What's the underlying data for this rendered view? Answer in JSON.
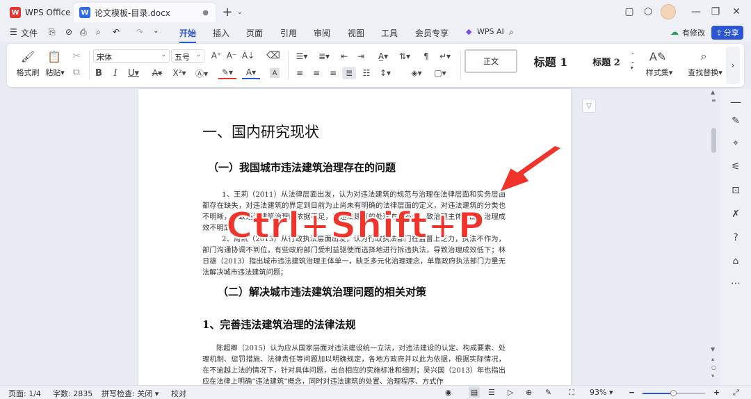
{
  "titlebar": {
    "app_tab": "WPS Office",
    "doc_tab": "论文模板-目录.docx",
    "new_tab": "+",
    "app_logo": "W",
    "doc_logo": "W"
  },
  "menubar": {
    "file": "文件",
    "tabs": [
      "开始",
      "插入",
      "页面",
      "引用",
      "审阅",
      "视图",
      "工具",
      "会员专享"
    ],
    "wps_ai": "WPS AI",
    "edit_mode": "有修改",
    "share": "分享"
  },
  "ribbon": {
    "format_painter": "格式刷",
    "paste": "粘贴",
    "font_name": "宋体",
    "font_size": "五号",
    "style_normal": "正文",
    "style_h1": "标题 1",
    "style_h2": "标题 2",
    "styles": "样式集",
    "find_replace": "查找替换"
  },
  "document": {
    "h1": "一、国内研究现状",
    "h2a": "（一）我国城市违法建筑治理存在的问题",
    "p1": "1、王莉（2011）从法律层面出发，认为对违法建筑的规范与治理在法律层面和实务层面都存在缺失，对违法建筑的界定到目前为止尚未有明确的法律层面的定义，对违法建筑的分类也不明晰，导致违法建筑治理的依据不足，对违法建筑的处理方式不一，致治理主体混乱，治理成效不明显；",
    "p2": "2、周凯（2013）从行政执法层面出发，认为行政执法部门在监督上乏力，执法不作为，部门沟通协调不到位，有些政府部门受利益驱使而选择地进行拆违执法，导致治理成效低下；林日雄（2013）指出城市违法建筑治理主体单一，缺乏多元化治理理念，单靠政府执法部门力量无法解决城市违法建筑问题；",
    "h2b": "（二）解决城市违法建筑治理问题的相关对策",
    "h3": "1、完善违法建筑治理的法律法规",
    "p3": "陈超卿（2015）认为应从国家层面对违法建设统一立法，对违法建设的认定、构成要素、处理机制、惩罚措施、法律责任等问题加以明确规定，各地方政府并以此为依据，根据实际情况，在不逾越上法的情况下，针对具体问题，出台相应的实施标准和细则；吴兴国（2013）年也指出应在法律上明确“违法建筑”概念，同时对违法建筑的处置、治理程序、方式作"
  },
  "overlay": {
    "shortcut": "Ctrl+Shift+P"
  },
  "statusbar": {
    "page": "页面: 1/4",
    "words": "字数: 2835",
    "spell": "拼写检查: 关闭",
    "proof": "校对",
    "zoom": "93%"
  },
  "colors": {
    "accent": "#2a56d6",
    "arrow": "#f0342b"
  }
}
